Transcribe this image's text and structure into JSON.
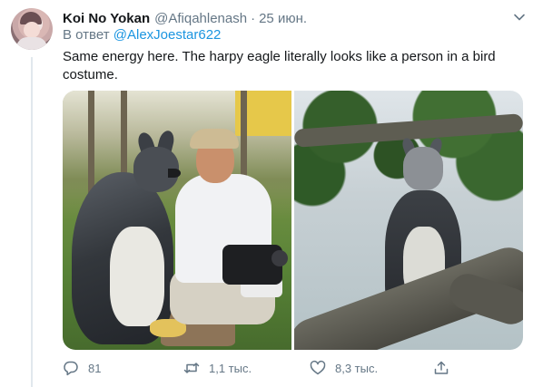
{
  "tweet": {
    "author_name": "Koi No Yokan",
    "author_handle": "@Afiqahlenash",
    "separator": "·",
    "date": "25 июн.",
    "reply_prefix": "В ответ",
    "reply_to": "@AlexJoestar622",
    "text": "Same energy here. The harpy eagle literally looks like a person in a bird costume."
  },
  "actions": {
    "replies": "81",
    "retweets": "1,1 тыс.",
    "likes": "8,3 тыс."
  },
  "icons": {
    "menu": "chevron-down-icon",
    "reply": "reply-icon",
    "retweet": "retweet-icon",
    "like": "heart-icon",
    "share": "share-icon"
  },
  "colors": {
    "link": "#1b95e0",
    "secondary_text": "#657786",
    "primary_text": "#14171a"
  }
}
